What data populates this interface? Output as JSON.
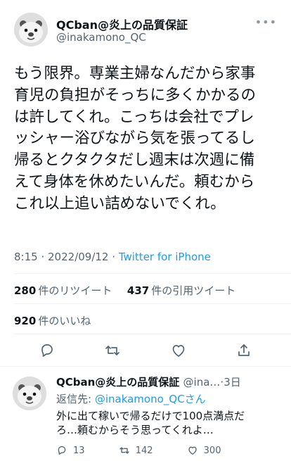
{
  "tweet": {
    "display_name": "QCban@炎上の品質保証",
    "handle": "@inakamono_QC",
    "more_icon": "•••",
    "text_lines": [
      "もう限界。専業主婦なんだから家事",
      "育児の負担がそっちに多くかかるの",
      "は許してくれ。こっちは会社でプレ",
      "ッシャー浴びながら気を張ってるし",
      "帰るとクタクタだし週末は次週に備",
      "えて身体を休めたいんだ。頼むから",
      "これ以上追い詰めないでくれ。"
    ],
    "time": "8:15",
    "date": "2022/09/12",
    "source": "Twitter for iPhone"
  },
  "stats": {
    "retweets_count": "280",
    "retweets_label": "件のリツイート",
    "quotes_count": "437",
    "quotes_label": "件の引用ツイート",
    "likes_count": "920",
    "likes_label": "件のいいね"
  },
  "actions": {
    "icons": [
      "reply-icon",
      "retweet-icon",
      "like-icon",
      "share-icon"
    ]
  },
  "reply": {
    "display_name": "QCban@炎上の品質保証",
    "handle": "@ina…",
    "age": "3日",
    "reply_to_label": "返信先: ",
    "reply_to_handle": "@inakamono_QCさん",
    "text_lines": [
      "外に出て稼いで帰るだけで100点満点だ",
      "ろ…頼むからそう思ってくれよ…"
    ],
    "replies": "13",
    "retweets": "142",
    "likes": "300"
  },
  "colors": {
    "accent": "#1d9bf0",
    "secondary_text": "#536471",
    "divider": "#eff3f4"
  }
}
